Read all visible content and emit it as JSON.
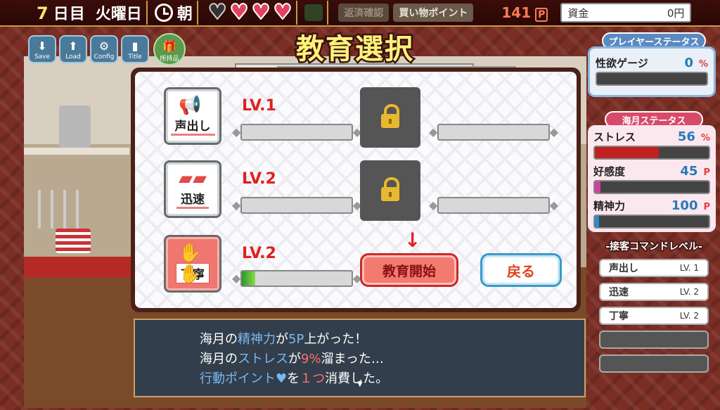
{
  "topbar": {
    "day_number": "7",
    "day_unit": "日目",
    "weekday": "火曜日",
    "time_of_day": "朝",
    "hearts": [
      "empty",
      "full",
      "full",
      "full"
    ],
    "repay_label": "返済確認",
    "shop_label": "買い物ポイント",
    "points_value": "141",
    "points_unit": "P",
    "money_label": "資金",
    "money_value": "0円"
  },
  "menu": {
    "save": "Save",
    "load": "Load",
    "config": "Config",
    "title": "Title",
    "items": "所持品"
  },
  "panel": {
    "title": "教育選択",
    "skills": [
      {
        "name": "声出し",
        "level": "LV.1",
        "progress": 0
      },
      {
        "name": "迅速",
        "level": "LV.2",
        "progress": 0
      },
      {
        "name": "丁寧",
        "level": "LV.2",
        "progress": 0.12
      }
    ],
    "start_label": "教育開始",
    "back_label": "戻る"
  },
  "player_status": {
    "header": "プレイヤーステータス",
    "lust_label": "性欲ゲージ",
    "lust_value": "0",
    "lust_unit": "%"
  },
  "haizuki_status": {
    "header": "海月ステータス",
    "stress_label": "ストレス",
    "stress_value": "56",
    "stress_unit": "%",
    "stress_fill": 0.56,
    "affection_label": "好感度",
    "affection_value": "45",
    "affection_unit": "P",
    "affection_fill": 0.05,
    "mind_label": "精神力",
    "mind_value": "100",
    "mind_unit": "P",
    "mind_fill": 0.04
  },
  "command_levels": {
    "header": "-接客コマンドレベル-",
    "items": [
      {
        "name": "声出し",
        "level": "LV. 1"
      },
      {
        "name": "迅速",
        "level": "LV. 2"
      },
      {
        "name": "丁寧",
        "level": "LV. 2"
      }
    ]
  },
  "message": {
    "line1_a": "海月の",
    "line1_b": "精神力",
    "line1_c": "が",
    "line1_d": "5P",
    "line1_e": "上がった！",
    "line2_a": "海月の",
    "line2_b": "ストレス",
    "line2_c": "が",
    "line2_d": "9%",
    "line2_e": "溜まった…",
    "line3_a": "行動ポイント",
    "line3_b": "♥",
    "line3_c": "を",
    "line3_d": "１つ",
    "line3_e": "消費した。"
  },
  "colors": {
    "accent_red": "#e02020",
    "stress_bar": "#c02020",
    "affection_bar": "#d040a0",
    "mind_bar": "#2a8ad8"
  }
}
